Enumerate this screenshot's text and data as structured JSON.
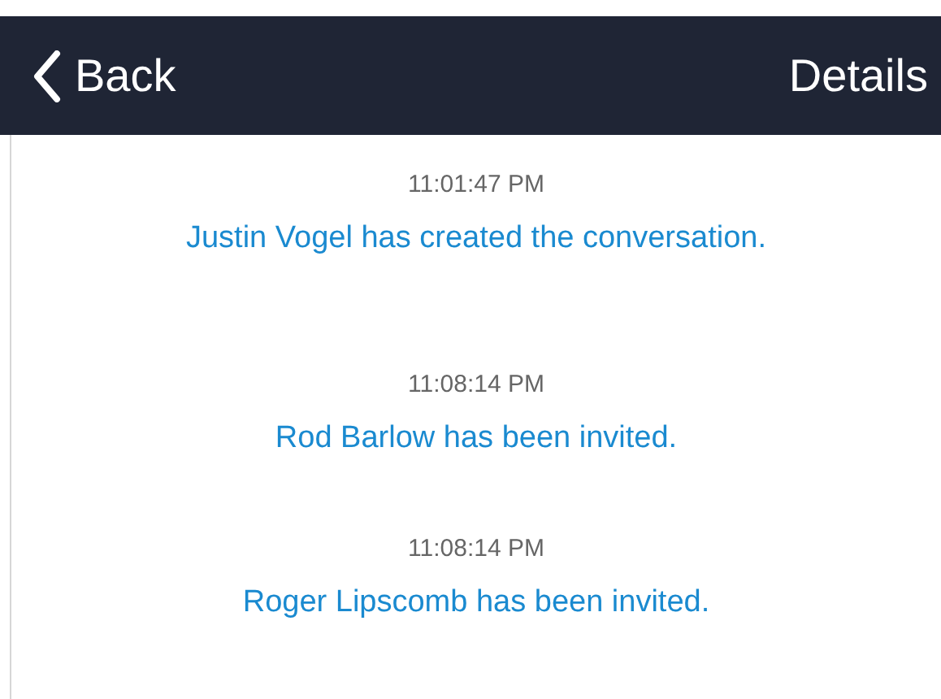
{
  "nav": {
    "back": "Back",
    "title": "Details"
  },
  "events": [
    {
      "time": "11:01:47 PM",
      "message": "Justin Vogel has created the conversation."
    },
    {
      "time": "11:08:14 PM",
      "message": "Rod Barlow has been invited."
    },
    {
      "time": "11:08:14 PM",
      "message": "Roger Lipscomb has been invited."
    }
  ]
}
